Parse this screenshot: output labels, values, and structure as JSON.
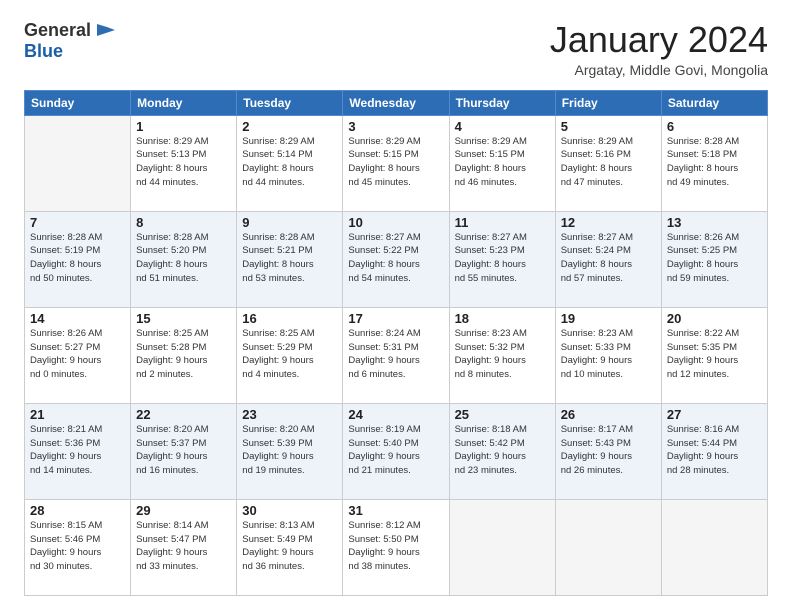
{
  "logo": {
    "general": "General",
    "blue": "Blue"
  },
  "header": {
    "month": "January 2024",
    "location": "Argatay, Middle Govi, Mongolia"
  },
  "days": [
    "Sunday",
    "Monday",
    "Tuesday",
    "Wednesday",
    "Thursday",
    "Friday",
    "Saturday"
  ],
  "weeks": [
    [
      {
        "date": "",
        "sunrise": "",
        "sunset": "",
        "daylight": ""
      },
      {
        "date": "1",
        "sunrise": "Sunrise: 8:29 AM",
        "sunset": "Sunset: 5:13 PM",
        "daylight": "Daylight: 8 hours and 44 minutes."
      },
      {
        "date": "2",
        "sunrise": "Sunrise: 8:29 AM",
        "sunset": "Sunset: 5:14 PM",
        "daylight": "Daylight: 8 hours and 44 minutes."
      },
      {
        "date": "3",
        "sunrise": "Sunrise: 8:29 AM",
        "sunset": "Sunset: 5:15 PM",
        "daylight": "Daylight: 8 hours and 45 minutes."
      },
      {
        "date": "4",
        "sunrise": "Sunrise: 8:29 AM",
        "sunset": "Sunset: 5:15 PM",
        "daylight": "Daylight: 8 hours and 46 minutes."
      },
      {
        "date": "5",
        "sunrise": "Sunrise: 8:29 AM",
        "sunset": "Sunset: 5:16 PM",
        "daylight": "Daylight: 8 hours and 47 minutes."
      },
      {
        "date": "6",
        "sunrise": "Sunrise: 8:28 AM",
        "sunset": "Sunset: 5:18 PM",
        "daylight": "Daylight: 8 hours and 49 minutes."
      }
    ],
    [
      {
        "date": "7",
        "sunrise": "Sunrise: 8:28 AM",
        "sunset": "Sunset: 5:19 PM",
        "daylight": "Daylight: 8 hours and 50 minutes."
      },
      {
        "date": "8",
        "sunrise": "Sunrise: 8:28 AM",
        "sunset": "Sunset: 5:20 PM",
        "daylight": "Daylight: 8 hours and 51 minutes."
      },
      {
        "date": "9",
        "sunrise": "Sunrise: 8:28 AM",
        "sunset": "Sunset: 5:21 PM",
        "daylight": "Daylight: 8 hours and 53 minutes."
      },
      {
        "date": "10",
        "sunrise": "Sunrise: 8:27 AM",
        "sunset": "Sunset: 5:22 PM",
        "daylight": "Daylight: 8 hours and 54 minutes."
      },
      {
        "date": "11",
        "sunrise": "Sunrise: 8:27 AM",
        "sunset": "Sunset: 5:23 PM",
        "daylight": "Daylight: 8 hours and 55 minutes."
      },
      {
        "date": "12",
        "sunrise": "Sunrise: 8:27 AM",
        "sunset": "Sunset: 5:24 PM",
        "daylight": "Daylight: 8 hours and 57 minutes."
      },
      {
        "date": "13",
        "sunrise": "Sunrise: 8:26 AM",
        "sunset": "Sunset: 5:25 PM",
        "daylight": "Daylight: 8 hours and 59 minutes."
      }
    ],
    [
      {
        "date": "14",
        "sunrise": "Sunrise: 8:26 AM",
        "sunset": "Sunset: 5:27 PM",
        "daylight": "Daylight: 9 hours and 0 minutes."
      },
      {
        "date": "15",
        "sunrise": "Sunrise: 8:25 AM",
        "sunset": "Sunset: 5:28 PM",
        "daylight": "Daylight: 9 hours and 2 minutes."
      },
      {
        "date": "16",
        "sunrise": "Sunrise: 8:25 AM",
        "sunset": "Sunset: 5:29 PM",
        "daylight": "Daylight: 9 hours and 4 minutes."
      },
      {
        "date": "17",
        "sunrise": "Sunrise: 8:24 AM",
        "sunset": "Sunset: 5:31 PM",
        "daylight": "Daylight: 9 hours and 6 minutes."
      },
      {
        "date": "18",
        "sunrise": "Sunrise: 8:23 AM",
        "sunset": "Sunset: 5:32 PM",
        "daylight": "Daylight: 9 hours and 8 minutes."
      },
      {
        "date": "19",
        "sunrise": "Sunrise: 8:23 AM",
        "sunset": "Sunset: 5:33 PM",
        "daylight": "Daylight: 9 hours and 10 minutes."
      },
      {
        "date": "20",
        "sunrise": "Sunrise: 8:22 AM",
        "sunset": "Sunset: 5:35 PM",
        "daylight": "Daylight: 9 hours and 12 minutes."
      }
    ],
    [
      {
        "date": "21",
        "sunrise": "Sunrise: 8:21 AM",
        "sunset": "Sunset: 5:36 PM",
        "daylight": "Daylight: 9 hours and 14 minutes."
      },
      {
        "date": "22",
        "sunrise": "Sunrise: 8:20 AM",
        "sunset": "Sunset: 5:37 PM",
        "daylight": "Daylight: 9 hours and 16 minutes."
      },
      {
        "date": "23",
        "sunrise": "Sunrise: 8:20 AM",
        "sunset": "Sunset: 5:39 PM",
        "daylight": "Daylight: 9 hours and 19 minutes."
      },
      {
        "date": "24",
        "sunrise": "Sunrise: 8:19 AM",
        "sunset": "Sunset: 5:40 PM",
        "daylight": "Daylight: 9 hours and 21 minutes."
      },
      {
        "date": "25",
        "sunrise": "Sunrise: 8:18 AM",
        "sunset": "Sunset: 5:42 PM",
        "daylight": "Daylight: 9 hours and 23 minutes."
      },
      {
        "date": "26",
        "sunrise": "Sunrise: 8:17 AM",
        "sunset": "Sunset: 5:43 PM",
        "daylight": "Daylight: 9 hours and 26 minutes."
      },
      {
        "date": "27",
        "sunrise": "Sunrise: 8:16 AM",
        "sunset": "Sunset: 5:44 PM",
        "daylight": "Daylight: 9 hours and 28 minutes."
      }
    ],
    [
      {
        "date": "28",
        "sunrise": "Sunrise: 8:15 AM",
        "sunset": "Sunset: 5:46 PM",
        "daylight": "Daylight: 9 hours and 30 minutes."
      },
      {
        "date": "29",
        "sunrise": "Sunrise: 8:14 AM",
        "sunset": "Sunset: 5:47 PM",
        "daylight": "Daylight: 9 hours and 33 minutes."
      },
      {
        "date": "30",
        "sunrise": "Sunrise: 8:13 AM",
        "sunset": "Sunset: 5:49 PM",
        "daylight": "Daylight: 9 hours and 36 minutes."
      },
      {
        "date": "31",
        "sunrise": "Sunrise: 8:12 AM",
        "sunset": "Sunset: 5:50 PM",
        "daylight": "Daylight: 9 hours and 38 minutes."
      },
      {
        "date": "",
        "sunrise": "",
        "sunset": "",
        "daylight": ""
      },
      {
        "date": "",
        "sunrise": "",
        "sunset": "",
        "daylight": ""
      },
      {
        "date": "",
        "sunrise": "",
        "sunset": "",
        "daylight": ""
      }
    ]
  ]
}
